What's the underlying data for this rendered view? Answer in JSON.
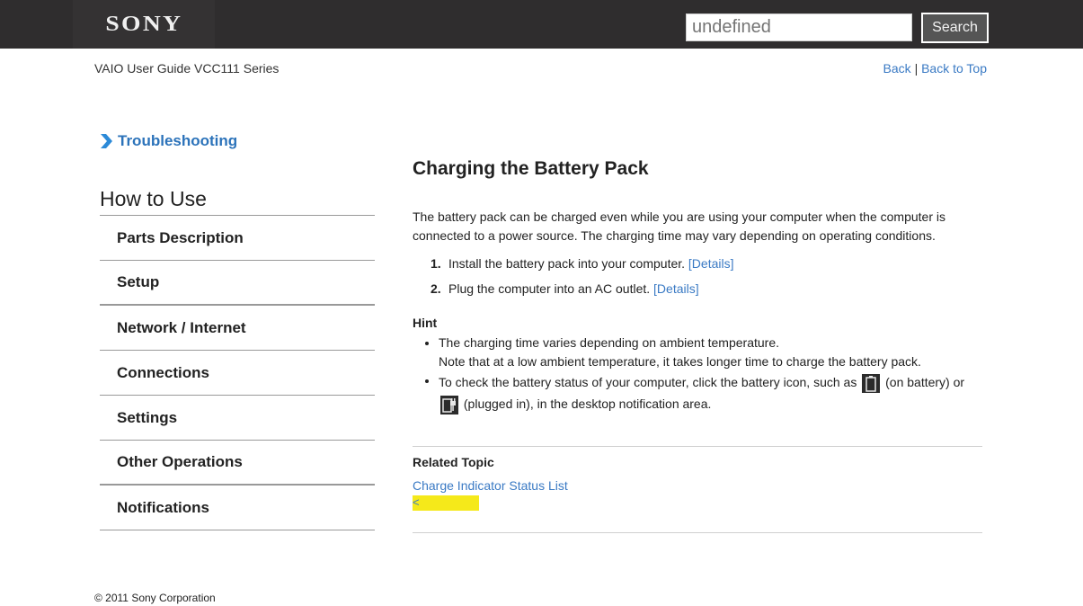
{
  "header": {
    "brand": "SONY",
    "search": {
      "value": "",
      "placeholder": "undefined",
      "button_label": "Search"
    }
  },
  "subheader": {
    "guide_title": "VAIO User Guide VCC111 Series",
    "back_label": "Back",
    "separator": "|",
    "back_to_top_label": "Back to Top"
  },
  "sidebar": {
    "troubleshooting_label": "Troubleshooting",
    "section_title": "How to Use",
    "items": [
      {
        "label": "Parts Description"
      },
      {
        "label": "Setup"
      },
      {
        "label": "Network / Internet"
      },
      {
        "label": "Connections"
      },
      {
        "label": "Settings"
      },
      {
        "label": "Other Operations"
      },
      {
        "label": "Notifications"
      }
    ]
  },
  "article": {
    "title": "Charging the Battery Pack",
    "intro": "The battery pack can be charged even while you are using your computer when the computer is connected to a power source. The charging time may vary depending on operating conditions.",
    "steps": [
      {
        "number": "1.",
        "text": "Install the battery pack into your computer. ",
        "link": "[Details]"
      },
      {
        "number": "2.",
        "text": "Plug the computer into an AC outlet. ",
        "link": "[Details]"
      }
    ],
    "hint": {
      "title": "Hint",
      "items": [
        {
          "line1": "The charging time varies depending on ambient temperature.",
          "line2": "Note that at a low ambient temperature, it takes longer time to charge the battery pack."
        },
        {
          "part1": "To check the battery status of your computer, click the battery icon, such as ",
          "part2": " (on battery) or ",
          "part3": " (plugged in), in the desktop notification area."
        }
      ]
    },
    "related": {
      "title": "Related Topic",
      "links": [
        "Charge Indicator Status List"
      ],
      "prev_label": "<"
    }
  },
  "footer": {
    "copyright": "© 2011 Sony Corporation"
  },
  "colors": {
    "header_bg": "#2f2d2e",
    "link": "#3a7ac4",
    "highlight": "#f5e91a"
  }
}
